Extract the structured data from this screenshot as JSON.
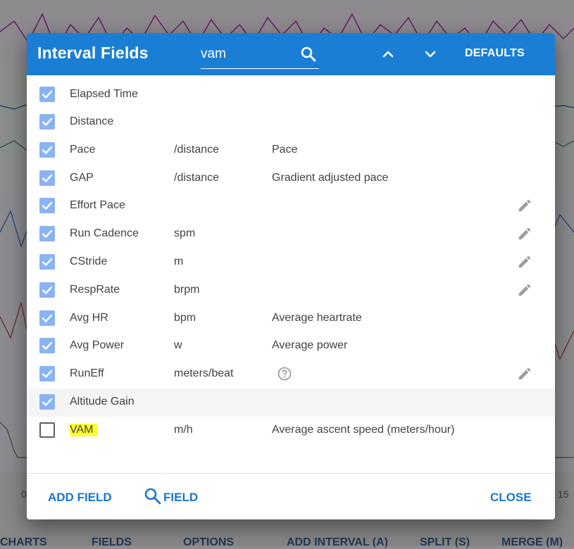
{
  "dialog": {
    "title": "Interval Fields",
    "search": {
      "value": "vam",
      "icon": "search-icon"
    },
    "header_buttons": {
      "prev_icon": "chevron-up-icon",
      "next_icon": "chevron-down-icon",
      "defaults_label": "DEFAULTS"
    },
    "fields": [
      {
        "checked": true,
        "name": "Elapsed Time",
        "unit": "",
        "description": "",
        "editable": false
      },
      {
        "checked": true,
        "name": "Distance",
        "unit": "",
        "description": "",
        "editable": false
      },
      {
        "checked": true,
        "name": "Pace",
        "unit": "/distance",
        "description": "Pace",
        "editable": false
      },
      {
        "checked": true,
        "name": "GAP",
        "unit": "/distance",
        "description": "Gradient adjusted pace",
        "editable": false
      },
      {
        "checked": true,
        "name": "Effort Pace",
        "unit": "",
        "description": "",
        "editable": true
      },
      {
        "checked": true,
        "name": "Run Cadence",
        "unit": "spm",
        "description": "",
        "editable": true
      },
      {
        "checked": true,
        "name": "CStride",
        "unit": "m",
        "description": "",
        "editable": true
      },
      {
        "checked": true,
        "name": "RespRate",
        "unit": "brpm",
        "description": "",
        "editable": true
      },
      {
        "checked": true,
        "name": "Avg HR",
        "unit": "bpm",
        "description": "Average heartrate",
        "editable": false
      },
      {
        "checked": true,
        "name": "Avg Power",
        "unit": "w",
        "description": "Average power",
        "editable": false
      },
      {
        "checked": true,
        "name": "RunEff",
        "unit": "meters/beat",
        "description": "",
        "help": true,
        "editable": true
      },
      {
        "checked": true,
        "name": "Altitude Gain",
        "unit": "",
        "description": "",
        "editable": false,
        "hover": true
      },
      {
        "checked": false,
        "name": "VAM",
        "unit": "m/h",
        "description": "Average ascent speed (meters/hour)",
        "editable": false,
        "highlight": true
      }
    ],
    "footer": {
      "add_field": "ADD FIELD",
      "search_field": "FIELD",
      "close": "CLOSE"
    }
  },
  "background": {
    "toolbar": [
      "CHARTS",
      "FIELDS",
      "OPTIONS",
      "ADD INTERVAL (A)",
      "SPLIT (S)",
      "MERGE (M)"
    ],
    "axis_ticks": [
      "0",
      "15"
    ]
  },
  "colors": {
    "header": "#1a7ed4",
    "checkbox_checked": "#8ab4f0",
    "link": "#1976d2",
    "highlight": "#ffff33"
  }
}
